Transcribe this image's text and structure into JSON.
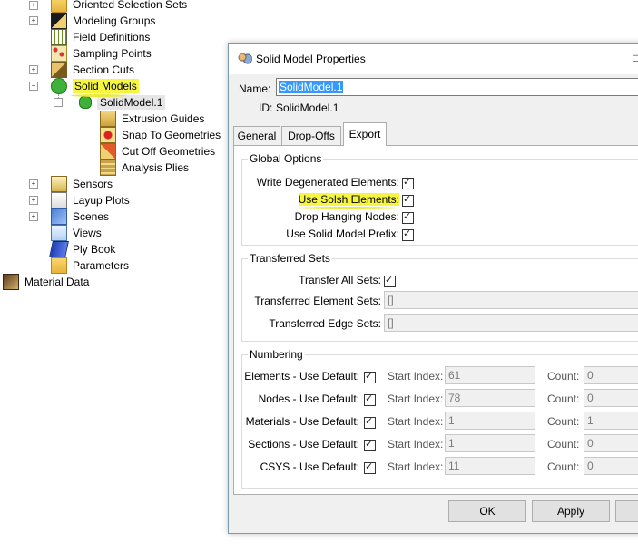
{
  "tree": {
    "items": [
      {
        "label": "Oriented Selection Sets",
        "icon": "folder-icon"
      },
      {
        "label": "Modeling Groups",
        "icon": "modeling-groups-icon"
      },
      {
        "label": "Field Definitions",
        "icon": "field-definitions-icon"
      },
      {
        "label": "Sampling Points",
        "icon": "sampling-points-icon"
      },
      {
        "label": "Section Cuts",
        "icon": "section-cuts-icon"
      },
      {
        "label": "Solid Models",
        "icon": "solid-models-icon"
      },
      {
        "label": "SolidModel.1",
        "icon": "solid-model-icon"
      },
      {
        "label": "Extrusion Guides",
        "icon": "extrusion-guides-icon"
      },
      {
        "label": "Snap To Geometries",
        "icon": "snap-to-geometries-icon"
      },
      {
        "label": "Cut Off Geometries",
        "icon": "cut-off-geometries-icon"
      },
      {
        "label": "Analysis Plies",
        "icon": "analysis-plies-icon"
      },
      {
        "label": "Sensors",
        "icon": "sensors-icon"
      },
      {
        "label": "Layup Plots",
        "icon": "layup-plots-icon"
      },
      {
        "label": "Scenes",
        "icon": "scenes-icon"
      },
      {
        "label": "Views",
        "icon": "views-icon"
      },
      {
        "label": "Ply Book",
        "icon": "ply-book-icon"
      },
      {
        "label": "Parameters",
        "icon": "parameters-icon"
      },
      {
        "label": "Material Data",
        "icon": "material-data-icon"
      }
    ],
    "highlight_color": "#f5f542"
  },
  "dialog": {
    "title": "Solid Model Properties",
    "close_glyph": "□",
    "name_label": "Name:",
    "name_value": "SolidModel.1",
    "id_label": "ID:",
    "id_value": "SolidModel.1",
    "tabs": [
      "General",
      "Drop-Offs",
      "Export"
    ],
    "active_tab": "Export",
    "global_options": {
      "title": "Global Options",
      "items": [
        {
          "label": "Write Degenerated Elements:",
          "checked": true
        },
        {
          "label": "Use Solsh Elements:",
          "checked": true
        },
        {
          "label": "Drop Hanging Nodes:",
          "checked": true
        },
        {
          "label": "Use Solid Model Prefix:",
          "checked": true
        }
      ]
    },
    "transferred_sets": {
      "title": "Transferred Sets",
      "transfer_all_label": "Transfer All Sets:",
      "transfer_all_checked": true,
      "element_sets_label": "Transferred Element Sets:",
      "element_sets_value": "[]",
      "edge_sets_label": "Transferred Edge Sets:",
      "edge_sets_value": "[]"
    },
    "numbering": {
      "title": "Numbering",
      "start_index_label": "Start Index:",
      "count_label": "Count:",
      "rows": [
        {
          "label": "Elements - Use Default:",
          "start": "61",
          "count": "0"
        },
        {
          "label": "Nodes - Use Default:",
          "start": "78",
          "count": "0"
        },
        {
          "label": "Materials - Use Default:",
          "start": "1",
          "count": "1"
        },
        {
          "label": "Sections - Use Default:",
          "start": "1",
          "count": "0"
        },
        {
          "label": "CSYS - Use Default:",
          "start": "11",
          "count": "0"
        }
      ]
    },
    "buttons": {
      "ok": "OK",
      "apply": "Apply"
    }
  }
}
